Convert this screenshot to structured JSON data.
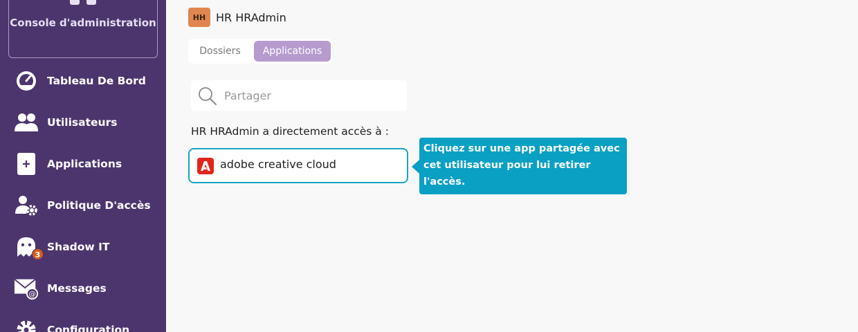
{
  "sidebar": {
    "console_label": "Console d'administration",
    "items": [
      {
        "label": "Tableau De Bord",
        "icon": "dashboard-icon"
      },
      {
        "label": "Utilisateurs",
        "icon": "users-icon"
      },
      {
        "label": "Applications",
        "icon": "add-app-icon"
      },
      {
        "label": "Politique D'accès",
        "icon": "user-gear-icon"
      },
      {
        "label": "Shadow IT",
        "icon": "ghost-icon",
        "badge": "3"
      },
      {
        "label": "Messages",
        "icon": "mail-icon"
      },
      {
        "label": "Configuration",
        "icon": "gear-icon"
      }
    ]
  },
  "user": {
    "initials": "HH",
    "name": "HR HRAdmin"
  },
  "tabs": [
    {
      "label": "Dossiers"
    },
    {
      "label": "Applications"
    }
  ],
  "search": {
    "placeholder": "Partager",
    "value": ""
  },
  "access_text": "HR HRAdmin a directement accès à :",
  "apps": [
    {
      "name": "adobe creative cloud",
      "icon": "adobe-icon"
    }
  ],
  "tooltip": {
    "text": "Cliquez sur une app partagée avec cet utilisateur pour lui retirer l'accès."
  },
  "colors": {
    "sidebar_bg": "#4c356d",
    "accent_tab": "#b79bcf",
    "tooltip_bg": "#0aa0c4",
    "card_border": "#1aa3c6",
    "badge": "#d45e1e",
    "avatar": "#e0874f",
    "adobe": "#e1251b"
  }
}
